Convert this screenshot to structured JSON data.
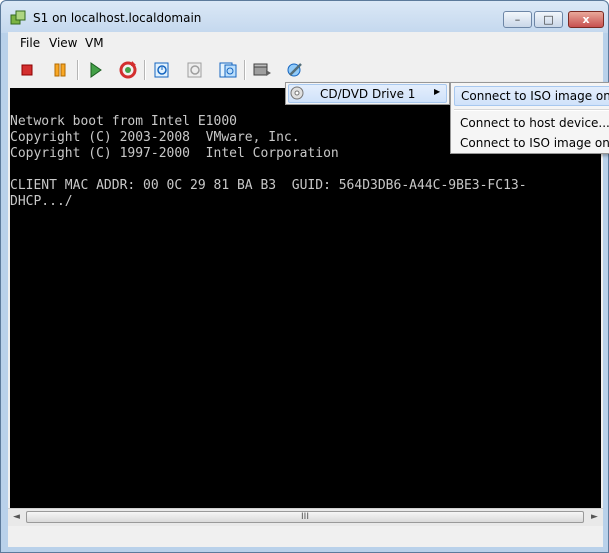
{
  "window": {
    "title": "S1 on localhost.localdomain",
    "minimize_glyph": "–",
    "maximize_glyph": "□",
    "close_glyph": "x"
  },
  "menubar": {
    "items": [
      "File",
      "View",
      "VM"
    ]
  },
  "toolbar": {
    "buttons": [
      "stop-icon",
      "pause-icon",
      "play-icon",
      "reset-icon",
      "snapshot-icon",
      "revert-snapshot-icon",
      "manage-snapshots-icon",
      "cd-dvd-device-icon",
      "edit-settings-icon"
    ]
  },
  "console": {
    "lines": [
      "Network boot from Intel E1000",
      "Copyright (C) 2003-2008  VMware, Inc.",
      "Copyright (C) 1997-2000  Intel Corporation",
      "",
      "CLIENT MAC ADDR: 00 0C 29 81 BA B3  GUID: 564D3DB6-A44C-9BE3-FC13-",
      "DHCP.../"
    ]
  },
  "scrollbar": {
    "left_arrow": "◄",
    "right_arrow": "►",
    "grip": "III"
  },
  "context_menu": {
    "item_label": "CD/DVD Drive 1",
    "arrow": "▶"
  },
  "submenu": {
    "items": [
      "Connect to ISO image on lo",
      "Connect to host device...",
      "Connect to ISO image on a"
    ]
  }
}
